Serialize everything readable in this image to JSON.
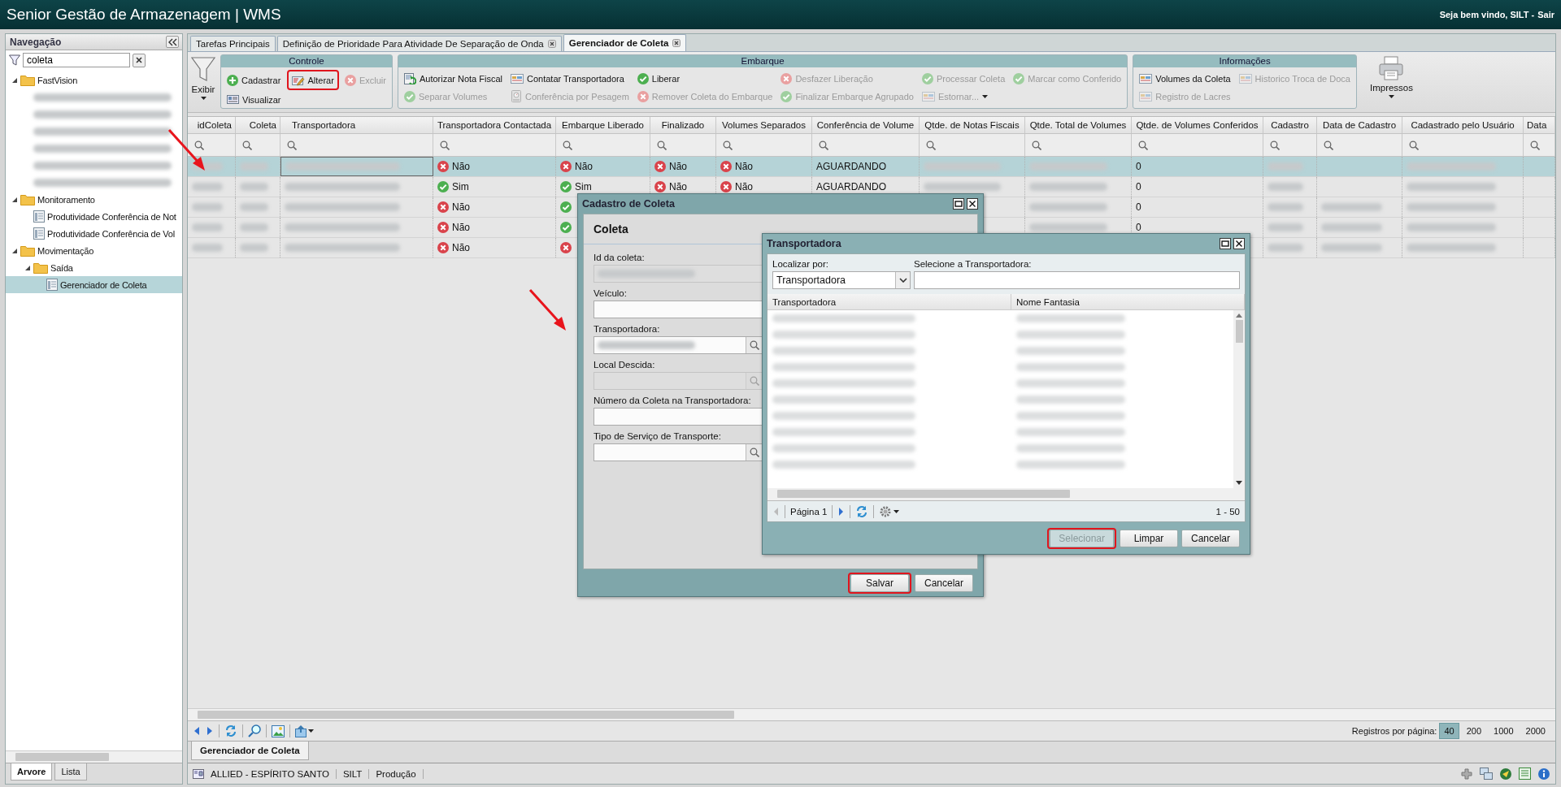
{
  "window": {
    "title": "Senior Gestão de Armazenagem | WMS",
    "greeting": "Seja bem vindo, SILT -",
    "logout": "Sair"
  },
  "sidebar": {
    "title": "Navegação",
    "search": {
      "value": "coleta"
    },
    "tree": [
      {
        "label": "FastVision",
        "kind": "folder",
        "expanded": true,
        "children": [
          {
            "kind": "redacted"
          },
          {
            "kind": "redacted"
          },
          {
            "kind": "redacted"
          },
          {
            "kind": "redacted"
          },
          {
            "kind": "redacted"
          },
          {
            "kind": "redacted"
          }
        ]
      },
      {
        "label": "Monitoramento",
        "kind": "folder",
        "expanded": true,
        "children": [
          {
            "label": "Produtividade Conferência de Not",
            "kind": "page",
            "selected": false
          },
          {
            "label": "Produtividade Conferência de Vol",
            "kind": "page",
            "selected": false
          }
        ]
      },
      {
        "label": "Movimentação",
        "kind": "folder",
        "expanded": true,
        "children": [
          {
            "label": "Saída",
            "kind": "folder",
            "expanded": true,
            "children": [
              {
                "label": "Gerenciador de Coleta",
                "kind": "page",
                "selected": true
              }
            ]
          }
        ]
      }
    ],
    "tabs": [
      {
        "label": "Arvore",
        "selected": true
      },
      {
        "label": "Lista",
        "selected": false
      }
    ]
  },
  "tabs": [
    {
      "label": "Tarefas Principais",
      "selected": false,
      "closable": false
    },
    {
      "label": "Definição de Prioridade Para Atividade De Separação de Onda",
      "selected": false,
      "closable": true
    },
    {
      "label": "Gerenciador de Coleta",
      "selected": true,
      "closable": true
    }
  ],
  "toolbar": {
    "view_button": "Exibir",
    "print_button": "Impressos",
    "groups": [
      {
        "title": "Controle",
        "kind": "controle",
        "buttons": [
          {
            "label": "Cadastrar",
            "kind": "add",
            "disabled": false,
            "highlighted": false
          },
          {
            "label": "Alterar",
            "kind": "edit",
            "disabled": false,
            "highlighted": true
          },
          {
            "label": "Excluir",
            "kind": "remove",
            "disabled": true,
            "highlighted": false
          },
          {
            "label": "Visualizar",
            "kind": "view",
            "disabled": false,
            "highlighted": false
          }
        ]
      },
      {
        "title": "Embarque",
        "kind": "embarque",
        "buttons": [
          {
            "label": "Autorizar Nota Fiscal",
            "kind": "auth",
            "disabled": false,
            "highlighted": false
          },
          {
            "label": "Contatar Transportadora",
            "kind": "report",
            "disabled": false,
            "highlighted": false
          },
          {
            "label": "Liberar",
            "kind": "check",
            "disabled": false,
            "highlighted": false
          },
          {
            "label": "Desfazer Liberação",
            "kind": "remove",
            "disabled": true,
            "highlighted": false
          },
          {
            "label": "Processar Coleta",
            "kind": "check",
            "disabled": true,
            "highlighted": false
          },
          {
            "label": "Marcar como Conferido",
            "kind": "check",
            "disabled": true,
            "highlighted": false
          },
          {
            "label": "Separar Volumes",
            "kind": "check",
            "disabled": true,
            "highlighted": false
          },
          {
            "label": "Conferência por Pesagem",
            "kind": "scale",
            "disabled": true,
            "highlighted": false
          },
          {
            "label": "Remover Coleta do Embarque",
            "kind": "remove",
            "disabled": true,
            "highlighted": false
          },
          {
            "label": "Finalizar Embarque Agrupado",
            "kind": "check",
            "disabled": true,
            "highlighted": false
          },
          {
            "label": "Estornar...",
            "kind": "report",
            "disabled": true,
            "highlighted": false,
            "menu": true
          }
        ]
      },
      {
        "title": "Informações",
        "kind": "info",
        "buttons": [
          {
            "label": "Volumes da Coleta",
            "kind": "report",
            "disabled": false,
            "highlighted": false
          },
          {
            "label": "Historico Troca de Doca",
            "kind": "report",
            "disabled": true,
            "highlighted": false
          },
          {
            "label": "Registro de Lacres",
            "kind": "report",
            "disabled": true,
            "highlighted": false
          }
        ]
      }
    ]
  },
  "table": {
    "columns": [
      "idColeta",
      "Coleta",
      "Transportadora",
      "Transportadora Contactada",
      "Embarque Liberado",
      "Finalizado",
      "Volumes Separados",
      "Conferência de Volume",
      "Qtde. de Notas Fiscais",
      "Qtde. Total de Volumes",
      "Qtde. de Volumes Conferidos",
      "Cadastro",
      "Data de Cadastro",
      "Cadastrado pelo Usuário",
      "Data"
    ],
    "rows": [
      {
        "selected": true,
        "arrow": true,
        "cells": [
          {
            "kind": "redacted"
          },
          {
            "kind": "redacted"
          },
          {
            "kind": "redacted",
            "focused": true
          },
          {
            "kind": "flag",
            "on": false,
            "text": "Não"
          },
          {
            "kind": "flag",
            "on": false,
            "text": "Não"
          },
          {
            "kind": "flag",
            "on": false,
            "text": "Não"
          },
          {
            "kind": "flag",
            "on": false,
            "text": "Não"
          },
          {
            "kind": "text",
            "text": "AGUARDANDO"
          },
          {
            "kind": "redacted"
          },
          {
            "kind": "redacted"
          },
          {
            "kind": "text",
            "text": "0"
          },
          {
            "kind": "redacted"
          },
          null,
          {
            "kind": "redacted"
          },
          null
        ]
      },
      {
        "selected": false,
        "arrow": false,
        "cells": [
          {
            "kind": "redacted"
          },
          {
            "kind": "redacted"
          },
          {
            "kind": "redacted"
          },
          {
            "kind": "flag",
            "on": true,
            "text": "Sim"
          },
          {
            "kind": "flag",
            "on": true,
            "text": "Sim"
          },
          {
            "kind": "flag",
            "on": false,
            "text": "Não"
          },
          {
            "kind": "flag",
            "on": false,
            "text": "Não"
          },
          {
            "kind": "text",
            "text": "AGUARDANDO"
          },
          {
            "kind": "redacted"
          },
          {
            "kind": "redacted"
          },
          {
            "kind": "text",
            "text": "0"
          },
          {
            "kind": "redacted"
          },
          null,
          {
            "kind": "redacted"
          },
          null
        ]
      },
      {
        "selected": false,
        "arrow": false,
        "cells": [
          {
            "kind": "redacted"
          },
          {
            "kind": "redacted"
          },
          {
            "kind": "redacted"
          },
          {
            "kind": "flag",
            "on": false,
            "text": "Não"
          },
          {
            "kind": "flag",
            "on": true
          },
          null,
          null,
          null,
          null,
          {
            "kind": "redacted"
          },
          {
            "kind": "text",
            "text": "0"
          },
          {
            "kind": "redacted"
          },
          {
            "kind": "redacted"
          },
          {
            "kind": "redacted"
          },
          null
        ]
      },
      {
        "selected": false,
        "arrow": false,
        "cells": [
          {
            "kind": "redacted"
          },
          {
            "kind": "redacted"
          },
          {
            "kind": "redacted"
          },
          {
            "kind": "flag",
            "on": false,
            "text": "Não"
          },
          {
            "kind": "flag",
            "on": true
          },
          null,
          null,
          null,
          null,
          {
            "kind": "redacted"
          },
          {
            "kind": "text",
            "text": "0"
          },
          {
            "kind": "redacted"
          },
          {
            "kind": "redacted"
          },
          {
            "kind": "redacted"
          },
          null
        ]
      },
      {
        "selected": false,
        "arrow": false,
        "cells": [
          {
            "kind": "redacted"
          },
          {
            "kind": "redacted"
          },
          {
            "kind": "redacted"
          },
          {
            "kind": "flag",
            "on": false,
            "text": "Não"
          },
          {
            "kind": "flag",
            "on": false
          },
          null,
          null,
          null,
          null,
          null,
          null,
          {
            "kind": "redacted"
          },
          {
            "kind": "redacted"
          },
          {
            "kind": "redacted"
          },
          null
        ]
      }
    ]
  },
  "paging": {
    "label": "Registros por página:",
    "sizes": [
      {
        "label": "40",
        "selected": true
      },
      {
        "label": "200",
        "selected": false
      },
      {
        "label": "1000",
        "selected": false
      },
      {
        "label": "2000",
        "selected": false
      }
    ]
  },
  "bottom_tabs": [
    {
      "label": "Gerenciador de Coleta",
      "selected": true
    }
  ],
  "status_bar": {
    "items": [
      "ALLIED - ESPÍRITO SANTO",
      "SILT",
      "Produção"
    ]
  },
  "coleta_dialog": {
    "title": "Cadastro de Coleta",
    "section": "Coleta",
    "fields": [
      {
        "label": "Id da coleta:",
        "kind": "text",
        "disabled": true,
        "redacted": true,
        "arrow": false
      },
      {
        "label": "Veículo:",
        "kind": "text",
        "disabled": false,
        "redacted": false,
        "arrow": false
      },
      {
        "label": "Transportadora:",
        "kind": "lookup",
        "disabled": false,
        "redacted": true,
        "arrow": true
      },
      {
        "label": "Local Descida:",
        "kind": "lookup",
        "disabled": true,
        "redacted": false,
        "arrow": false
      },
      {
        "label": "Número da Coleta na Transportadora:",
        "kind": "text",
        "disabled": false,
        "redacted": false,
        "arrow": false
      },
      {
        "label": "Tipo de Serviço de Transporte:",
        "kind": "lookup",
        "disabled": false,
        "redacted": false,
        "arrow": false
      }
    ],
    "buttons": [
      {
        "label": "Salvar",
        "disabled": false,
        "highlighted": true
      },
      {
        "label": "Cancelar",
        "disabled": false,
        "highlighted": false
      }
    ]
  },
  "carrier_dialog": {
    "title": "Transportadora",
    "search_by_label": "Localizar por:",
    "search_by_value": "Transportadora",
    "search_label": "Selecione a Transportadora:",
    "columns": [
      "Transportadora",
      "Nome Fantasia"
    ],
    "rows": [
      {
        "cells": [
          {
            "kind": "redacted"
          },
          {
            "kind": "redacted"
          }
        ]
      },
      {
        "cells": [
          {
            "kind": "redacted"
          },
          {
            "kind": "redacted"
          }
        ]
      },
      {
        "cells": [
          {
            "kind": "redacted"
          },
          {
            "kind": "redacted"
          }
        ]
      },
      {
        "cells": [
          {
            "kind": "redacted"
          },
          {
            "kind": "redacted"
          }
        ]
      },
      {
        "cells": [
          {
            "kind": "redacted"
          },
          {
            "kind": "redacted"
          }
        ]
      },
      {
        "cells": [
          {
            "kind": "redacted"
          },
          {
            "kind": "redacted"
          }
        ]
      },
      {
        "cells": [
          {
            "kind": "redacted"
          },
          {
            "kind": "redacted"
          }
        ]
      },
      {
        "cells": [
          {
            "kind": "redacted"
          },
          {
            "kind": "redacted"
          }
        ]
      },
      {
        "cells": [
          {
            "kind": "redacted"
          },
          {
            "kind": "redacted"
          }
        ]
      },
      {
        "cells": [
          {
            "kind": "redacted"
          },
          {
            "kind": "redacted"
          }
        ]
      }
    ],
    "page": "Página 1",
    "range": "1 - 50",
    "buttons": [
      {
        "label": "Selecionar",
        "disabled": true,
        "highlighted": true
      },
      {
        "label": "Limpar",
        "disabled": false,
        "highlighted": false
      },
      {
        "label": "Cancelar",
        "disabled": false,
        "highlighted": false
      }
    ]
  }
}
